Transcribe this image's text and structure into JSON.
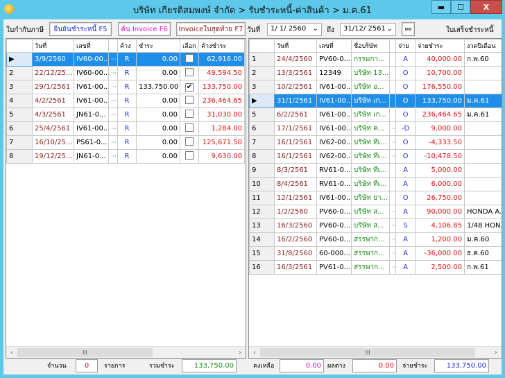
{
  "window": {
    "title": "บริษัท เกียรติสมพงษ์ จำกัด > รับชำระหนี้-ค่าสินค้า > ม.ค.61",
    "minimize": "▬",
    "maximize": "☐",
    "close": "X"
  },
  "toolbar": {
    "invoice_label": "ใบกำกับภาษี",
    "confirm_btn": "ยืนยันชำระหนี้ F5",
    "search_btn": "ค้น Invoice F6",
    "last_invoice_btn": "Invoiceใบสุดท้าย F7",
    "date_label": "วันที่",
    "date_from": "1/ 1/ 2560",
    "to_label": "ถึง",
    "date_to": "31/12/ 2561",
    "receipt_label": "ใบเสร็จชำระหนี้"
  },
  "left_grid": {
    "headers": [
      "",
      "วันที่",
      "เลขที่",
      "",
      "ค้าง",
      "ชำระ",
      "เลือก",
      "ค้างชำระ"
    ],
    "rows": [
      [
        "▶",
        "3/9/2560",
        "IV60-00...",
        "R",
        "0.00",
        false,
        "62,916.00"
      ],
      [
        "2",
        "22/12/25...",
        "IV60-00...",
        "R",
        "0.00",
        false,
        "49,594.50"
      ],
      [
        "3",
        "29/1/2561",
        "IV61-00...",
        "R",
        "133,750.00",
        true,
        "133,750.00"
      ],
      [
        "4",
        "4/2/2561",
        "IV61-00...",
        "R",
        "0.00",
        false,
        "236,464.65"
      ],
      [
        "5",
        "4/3/2561",
        "JN61-0...",
        "R",
        "0.00",
        false,
        "31,030.00"
      ],
      [
        "6",
        "25/4/2561",
        "IV61-00...",
        "R",
        "0.00",
        false,
        "1,284.00"
      ],
      [
        "7",
        "16/10/25...",
        "PS61-0...",
        "R",
        "0.00",
        false,
        "125,671.50"
      ],
      [
        "8",
        "19/12/25...",
        "JN61-0...",
        "R",
        "0.00",
        false,
        "9,630.00"
      ]
    ]
  },
  "right_grid": {
    "headers": [
      "",
      "วันที่",
      "เลขที่",
      "ชื่อบริษัท",
      "",
      "จ่าย",
      "จ่ายชำระ",
      "งวดปีเดือน"
    ],
    "rows": [
      [
        "1",
        "24/4/2560",
        "PV60-0...",
        "กรรมกา...",
        "A",
        "40,000.00",
        "ก.พ.60"
      ],
      [
        "2",
        "13/3/2561",
        "12349",
        "บริษัท 13...",
        "O",
        "10,700.00",
        ""
      ],
      [
        "3",
        "10/2/2561",
        "IV61-00...",
        "บริษัท อ...",
        "O",
        "176,550.00",
        ""
      ],
      [
        "▶",
        "31/1/2561",
        "IV61-00...",
        "บริษัท เก...",
        "O",
        "133,750.00",
        "ม.ค.61"
      ],
      [
        "5",
        "6/2/2561",
        "IV61-00...",
        "บริษัท เก...",
        "O",
        "236,464.65",
        "ม.ค.61"
      ],
      [
        "6",
        "17/1/2561",
        "IV61-00...",
        "บริษัท ค...",
        "-D",
        "9,000.00",
        ""
      ],
      [
        "7",
        "16/1/2561",
        "IV62-00...",
        "บริษัท ทีเ...",
        "O",
        "-4,333.50",
        ""
      ],
      [
        "8",
        "16/1/2561",
        "IV62-00...",
        "บริษัท ทีเ...",
        "O",
        "-10,478.50",
        ""
      ],
      [
        "9",
        "8/3/2561",
        "RV61-0...",
        "บริษัท ทีเ...",
        "A",
        "5,000.00",
        ""
      ],
      [
        "10",
        "8/4/2561",
        "RV61-0...",
        "บริษัท ทีเ...",
        "A",
        "6,000.00",
        ""
      ],
      [
        "11",
        "12/1/2561",
        "IV61-00...",
        "บริษัท ยา...",
        "O",
        "26,750.00",
        ""
      ],
      [
        "12",
        "1/2/2560",
        "PV60-0...",
        "บริษัท ส...",
        "A",
        "90,000.00",
        "HONDA A."
      ],
      [
        "13",
        "16/3/2560",
        "PV60-0...",
        "บริษัท ส...",
        "S",
        "4,106.85",
        "1/48 HON."
      ],
      [
        "14",
        "16/2/2560",
        "PV60-0...",
        "สรรพาก...",
        "A",
        "1,200.00",
        "ม.ค.60"
      ],
      [
        "15",
        "31/8/2560",
        "60-000...",
        "สรรพาก...",
        "A",
        "-36,000.00",
        "ธ.ค.60"
      ],
      [
        "16",
        "16/3/2561",
        "PV61-0...",
        "สรรพาก...",
        "A",
        "2,500.00",
        "ก.พ.61"
      ]
    ]
  },
  "footer": {
    "count_label": "จำนวน",
    "count": "0",
    "items_label": "รายการ",
    "total_label": "รวมชำระ",
    "total": "133,750.00",
    "balance_label": "คงเหลือ",
    "balance": "0.00",
    "diff_label": "ผลต่าง",
    "diff": "0.00",
    "paid_label": "จ่ายชำระ",
    "paid": "133,750.00"
  }
}
